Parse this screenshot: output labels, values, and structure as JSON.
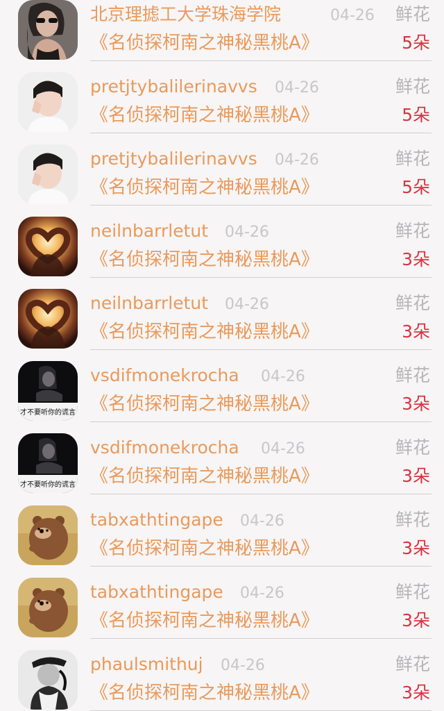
{
  "rows": [
    {
      "name": "北京理摅工大学珠海学院",
      "date": "04-26",
      "gift": "鲜花",
      "book": "《名侦探柯南之神秘黑桃A》",
      "count": "5朵",
      "avatar": "woman-sunglasses"
    },
    {
      "name": "pretjtybalilerinavvs",
      "date": "04-26",
      "gift": "鲜花",
      "book": "《名侦探柯南之神秘黑桃A》",
      "count": "5朵",
      "avatar": "boy-hand-face"
    },
    {
      "name": "pretjtybalilerinavvs",
      "date": "04-26",
      "gift": "鲜花",
      "book": "《名侦探柯南之神秘黑桃A》",
      "count": "5朵",
      "avatar": "boy-hand-face"
    },
    {
      "name": "neilnbarrletut",
      "date": "04-26",
      "gift": "鲜花",
      "book": "《名侦探柯南之神秘黑桃A》",
      "count": "3朵",
      "avatar": "heart-hands-sunset"
    },
    {
      "name": "neilnbarrletut",
      "date": "04-26",
      "gift": "鲜花",
      "book": "《名侦探柯南之神秘黑桃A》",
      "count": "3朵",
      "avatar": "heart-hands-sunset"
    },
    {
      "name": "vsdifmonekrocha",
      "date": "04-26",
      "gift": "鲜花",
      "book": "《名侦探柯南之神秘黑桃A》",
      "count": "3朵",
      "avatar": "dark-girl-caption",
      "avatar_caption": "才不要听你的谎言"
    },
    {
      "name": "vsdifmonekrocha",
      "date": "04-26",
      "gift": "鲜花",
      "book": "《名侦探柯南之神秘黑桃A》",
      "count": "3朵",
      "avatar": "dark-girl-caption",
      "avatar_caption": "才不要听你的谎言"
    },
    {
      "name": "tabxathtingape",
      "date": "04-26",
      "gift": "鲜花",
      "book": "《名侦探柯南之神秘黑桃A》",
      "count": "3朵",
      "avatar": "brown-bear"
    },
    {
      "name": "tabxathtingape",
      "date": "04-26",
      "gift": "鲜花",
      "book": "《名侦探柯南之神秘黑桃A》",
      "count": "3朵",
      "avatar": "brown-bear"
    },
    {
      "name": "phaulsmithuj",
      "date": "04-26",
      "gift": "鲜花",
      "book": "《名侦探柯南之神秘黑桃A》",
      "count": "3朵",
      "avatar": "bw-person-cap"
    }
  ],
  "colors": {
    "name": "#e99a5b",
    "date": "#c7c7c9",
    "gift": "#b5b5b7",
    "count": "#d9333f",
    "background": "#f7f5f6"
  }
}
